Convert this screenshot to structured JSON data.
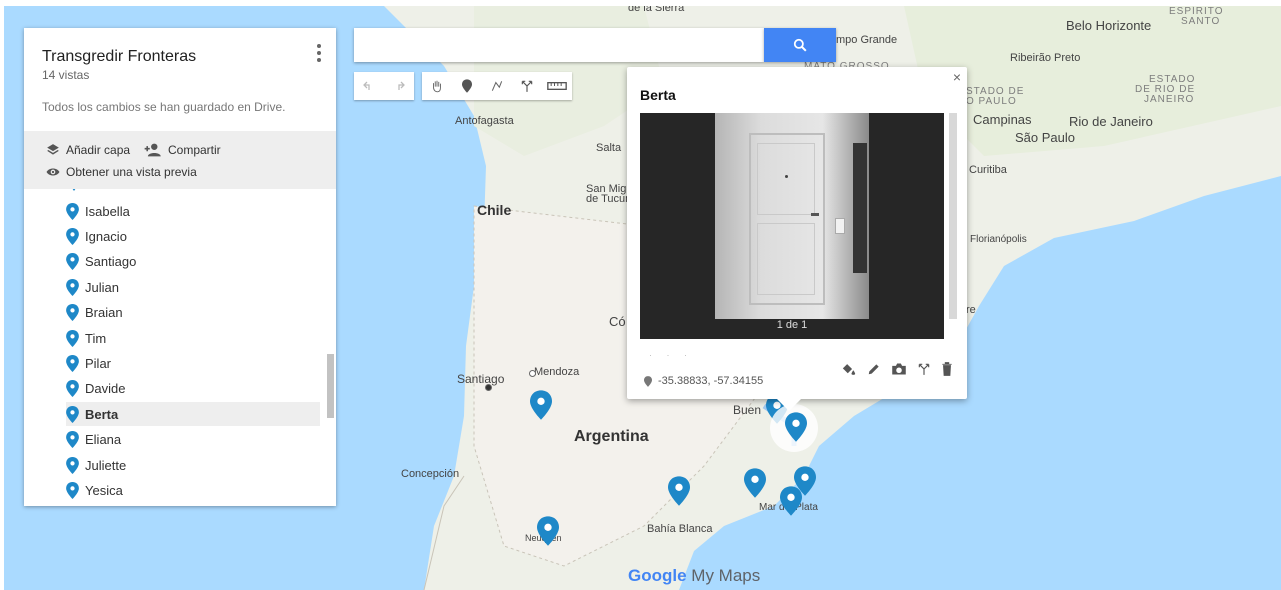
{
  "panel": {
    "title": "Transgredir Fronteras",
    "views": "14 vistas",
    "saved": "Todos los cambios se han guardado en Drive.",
    "add_layer": "Añadir capa",
    "share": "Compartir",
    "preview": "Obtener una vista previa",
    "items": [
      "Isabella",
      "Ignacio",
      "Santiago",
      "Julian",
      "Braian",
      "Tim",
      "Pilar",
      "Davide",
      "Berta",
      "Eliana",
      "Juliette",
      "Yesica"
    ],
    "selected": "Berta"
  },
  "search": {
    "value": "",
    "placeholder": ""
  },
  "map": {
    "labels": {
      "de_la_sierra": "de la Sierra",
      "campo_grande": "mpo Grande",
      "mato_grosso": "MATO GROSSO",
      "belo_horizonte": "Belo Horizonte",
      "espirito": "ESPÍRITO",
      "santo": "SANTO",
      "ribeirao": "Ribeirão Preto",
      "estado": "ESTADO",
      "rio_de": "DE RIO DE",
      "janeiro": "JANEIRO",
      "stado_de": "STADO DE",
      "o_paulo": "O PAULO",
      "campinas": "Campinas",
      "sao_paulo": "São Paulo",
      "rio_city": "Rio de Janeiro",
      "curitiba": "Curitiba",
      "florianopolis": "Florianópolis",
      "antofagasta": "Antofagasta",
      "salta": "Salta",
      "san_miguel": "San Mig",
      "de_tucuman": "de Tucum",
      "chile": "Chile",
      "cordoba": "Có",
      "santiago": "Santiago",
      "mendoza": "Mendoza",
      "argentina": "Argentina",
      "buenos": "Buen",
      "concepcion": "Concepción",
      "bahia": "Bahía Blanca",
      "mar_del_plata": "Mar del Plata",
      "neuquen": "Neuquén",
      "re": "re"
    },
    "brand_google": "Google",
    "brand_mymaps": " My Maps"
  },
  "infowindow": {
    "title": "Berta",
    "close": "×",
    "caption": "1 de 1",
    "coords": "-35.38833, -57.34155"
  },
  "colors": {
    "accent": "#4285f4",
    "pin": "#1e88c8"
  },
  "icons": [
    "search-icon",
    "undo-icon",
    "redo-icon",
    "hand-icon",
    "marker-icon",
    "draw-line-icon",
    "directions-icon",
    "ruler-icon",
    "layers-icon",
    "add-person-icon",
    "eye-icon",
    "paint-bucket-icon",
    "pencil-icon",
    "camera-icon",
    "trash-icon",
    "kebab-menu-icon",
    "close-icon"
  ]
}
